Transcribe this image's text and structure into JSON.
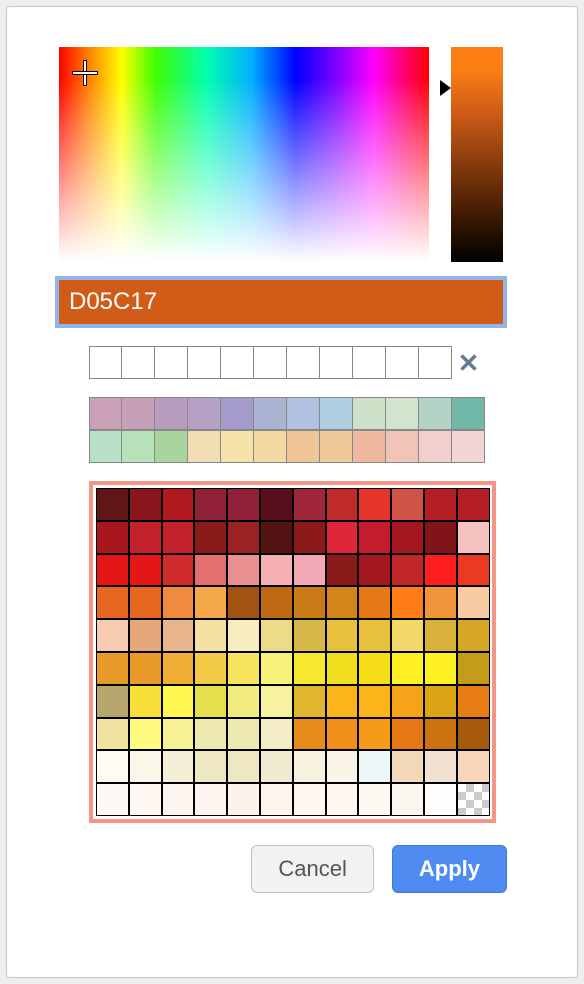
{
  "colors": {
    "current_hex": "D05C17",
    "hex_background": "#d05c17"
  },
  "custom_slots": [
    "",
    "",
    "",
    "",
    "",
    "",
    "",
    "",
    "",
    "",
    ""
  ],
  "preset_rows": [
    [
      "#cba0b8",
      "#c89fb9",
      "#b69dbd",
      "#b69fc5",
      "#a49acb",
      "#abb3d3",
      "#b1c2e0",
      "#aed0e1",
      "#cde1c9",
      "#d2e5cc",
      "#b4d3c6",
      "#71b8a8"
    ],
    [
      "#b7e0c6",
      "#b7e1b9",
      "#a9d39f",
      "#f0ddb4",
      "#f5e2a8",
      "#f2daa2",
      "#f0c598",
      "#f0c99a",
      "#eeb89f",
      "#f0c4b6",
      "#f1cfcc",
      "#f1d4d4"
    ]
  ],
  "swatches": [
    [
      "#621516",
      "#8a161d",
      "#b11820",
      "#8f2038",
      "#8f2038",
      "#590f1b",
      "#a0263a",
      "#bf2b2b",
      "#e63529",
      "#d05348",
      "#b31d23",
      "#b31d23"
    ],
    [
      "#a7171d",
      "#c1222c",
      "#c1222c",
      "#8b1a1a",
      "#9b2222",
      "#541313",
      "#8c1919",
      "#e0273a",
      "#c41c2b",
      "#a31820",
      "#811418",
      "#f6c1c1"
    ],
    [
      "#e41616",
      "#e41616",
      "#cf2b2b",
      "#e37070",
      "#e99090",
      "#f4b0b3",
      "#f1a7b4",
      "#8b1a1a",
      "#a31820",
      "#c12727",
      "#ff1e1e",
      "#ea3a21"
    ],
    [
      "#e66720",
      "#e66720",
      "#f08a3f",
      "#f4a74b",
      "#a15411",
      "#bf6a12",
      "#c97b17",
      "#d38517",
      "#e67816",
      "#ff7c19",
      "#f0953a",
      "#f8cba5"
    ],
    [
      "#f6ccb2",
      "#e6a77b",
      "#e8b58c",
      "#f3e0a2",
      "#f7ecbd",
      "#eddb8a",
      "#d7b94b",
      "#e7c03d",
      "#e7c03d",
      "#f2d76a",
      "#d8b13a",
      "#d6a627"
    ],
    [
      "#e79a28",
      "#e79a28",
      "#f0af34",
      "#f4cb47",
      "#f6e45c",
      "#f9f27a",
      "#f5e82e",
      "#f0df1f",
      "#f7de19",
      "#fff021",
      "#fff021",
      "#c59c17"
    ],
    [
      "#b7a56e",
      "#f8e038",
      "#fff752",
      "#e5df4d",
      "#f2ec80",
      "#f7f29e",
      "#e1b530",
      "#fcb41b",
      "#fcb41b",
      "#f6a319",
      "#daa415",
      "#e77c12"
    ],
    [
      "#f0e2a0",
      "#fffb80",
      "#f6f293",
      "#eee9b0",
      "#eee9b0",
      "#f4ecc6",
      "#e68c1a",
      "#f08f19",
      "#f59a19",
      "#e67816",
      "#cc730f",
      "#a85b0a"
    ],
    [
      "#fefcf0",
      "#fbf7e8",
      "#f5efd8",
      "#efe6c3",
      "#efe6c3",
      "#f1e9d0",
      "#f7f1df",
      "#faf5e6",
      "#edf7f7",
      "#f3d8b8",
      "#f1e1d3",
      "#f7d5b8"
    ],
    [
      "#fff9f5",
      "#fff7f2",
      "#fdf5f0",
      "#fef5f0",
      "#fdf3ed",
      "#fff4ed",
      "#fff7f0",
      "#fff7f0",
      "#fff9f4",
      "#faf5ef",
      "#fffefc",
      ""
    ]
  ],
  "buttons": {
    "cancel": "Cancel",
    "apply": "Apply"
  },
  "icons": {
    "delete_custom": "✕"
  }
}
